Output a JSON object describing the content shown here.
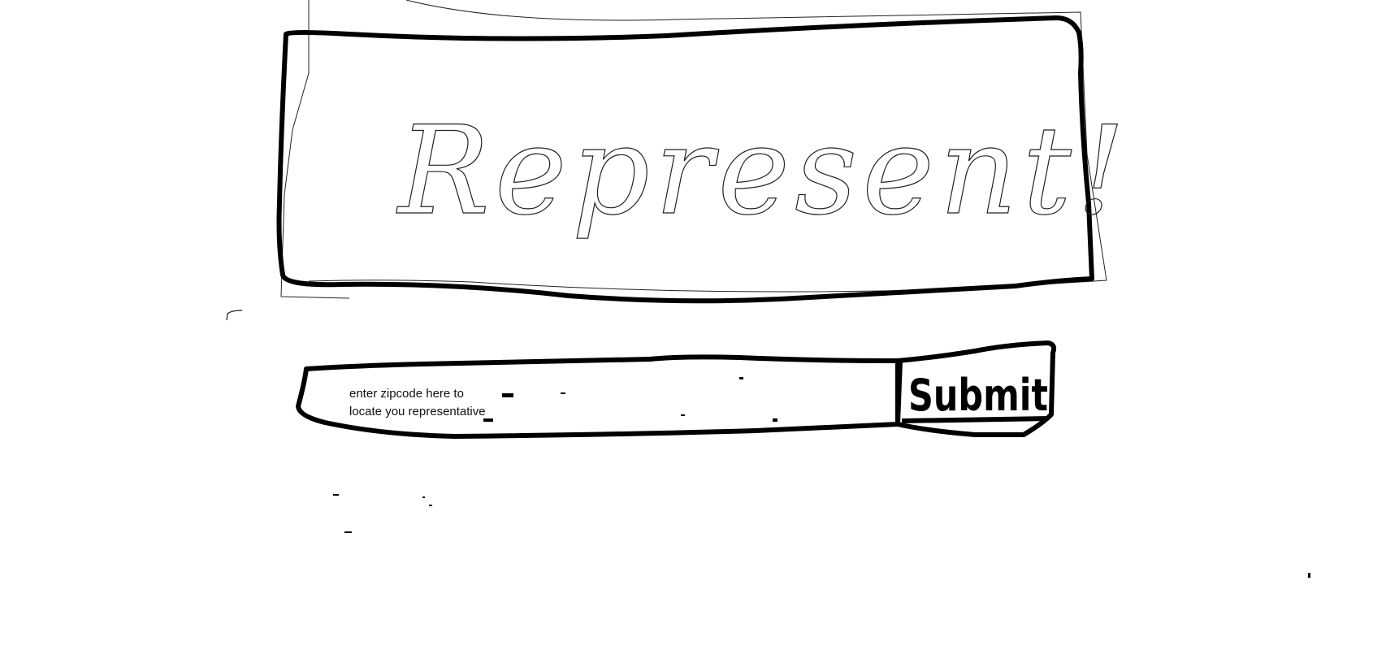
{
  "banner": {
    "title": "Represent!"
  },
  "search": {
    "hint": "enter zipcode here to locate you representative",
    "value": ""
  },
  "submit": {
    "label": "Submit"
  },
  "colors": {
    "ink": "#000000",
    "pencil": "#222222",
    "background": "#ffffff"
  }
}
